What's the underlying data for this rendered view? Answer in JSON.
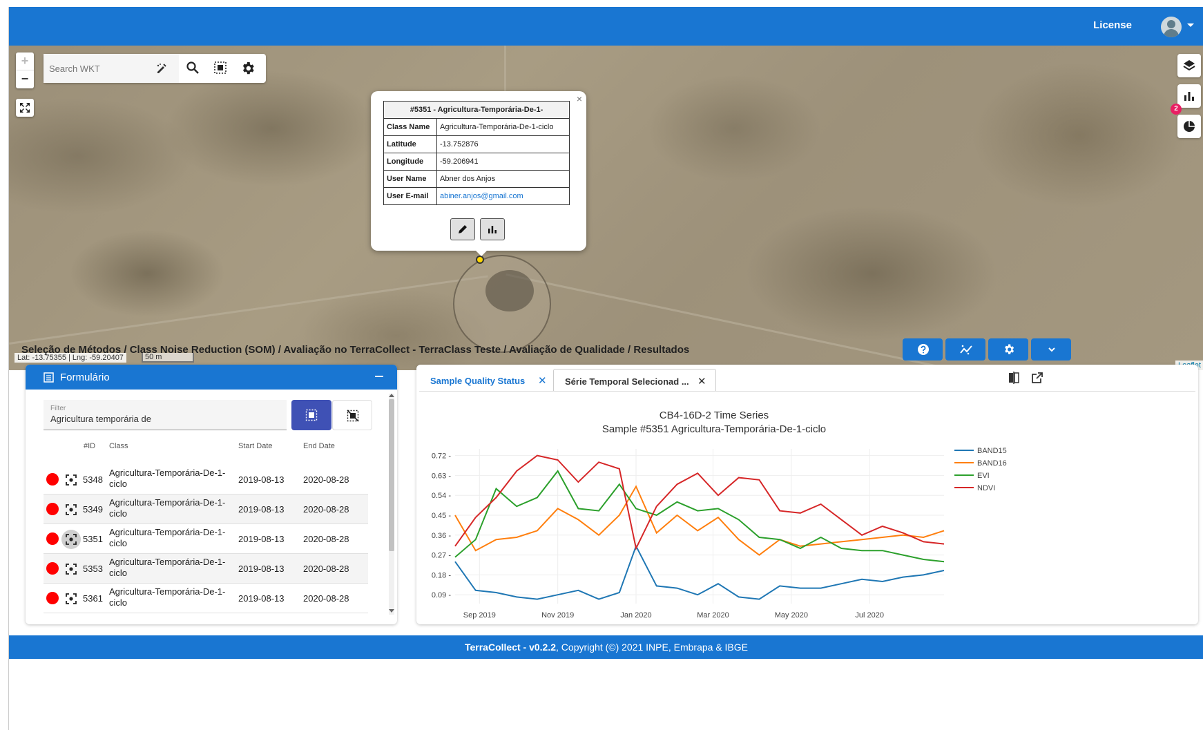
{
  "topbar": {
    "license": "License"
  },
  "map": {
    "search_placeholder": "Search WKT",
    "coords": "Lat: -13.75355 | Lng: -59.20407",
    "scale": "50 m",
    "attribution": "Leaflet",
    "badge_count": "2",
    "zoom_in": "+",
    "zoom_out": "−",
    "popup": {
      "title": "#5351 - Agricultura-Temporária-De-1-",
      "close": "×",
      "rows": [
        {
          "key": "Class Name",
          "value": "Agricultura-Temporária-De-1-ciclo"
        },
        {
          "key": "Latitude",
          "value": "-13.752876"
        },
        {
          "key": "Longitude",
          "value": "-59.206941"
        },
        {
          "key": "User Name",
          "value": "Abner dos Anjos"
        },
        {
          "key": "User E-mail",
          "value": "abiner.anjos@gmail.com"
        }
      ]
    }
  },
  "breadcrumb": "Seleção de Métodos / Class Noise Reduction (SOM) / Avaliação no TerraCollect - TerraClass Teste / Avaliação de Qualidade / Resultados",
  "form": {
    "title": "Formulário",
    "filter_label": "Filter",
    "filter_value": "Agricultura temporária de",
    "headers": {
      "id": "#ID",
      "class": "Class",
      "start": "Start Date",
      "end": "End Date"
    },
    "rows": [
      {
        "id": "5348",
        "class": "Agricultura-Temporária-De-1-ciclo",
        "start": "2019-08-13",
        "end": "2020-08-28"
      },
      {
        "id": "5349",
        "class": "Agricultura-Temporária-De-1-ciclo",
        "start": "2019-08-13",
        "end": "2020-08-28"
      },
      {
        "id": "5351",
        "class": "Agricultura-Temporária-De-1-ciclo",
        "start": "2019-08-13",
        "end": "2020-08-28"
      },
      {
        "id": "5353",
        "class": "Agricultura-Temporária-De-1-ciclo",
        "start": "2019-08-13",
        "end": "2020-08-28"
      },
      {
        "id": "5361",
        "class": "Agricultura-Temporária-De-1-ciclo",
        "start": "2019-08-13",
        "end": "2020-08-28"
      }
    ]
  },
  "tabs": [
    {
      "label": "Sample Quality Status",
      "close": "✕"
    },
    {
      "label": "Série Temporal Selecionad ...",
      "close": "✕"
    }
  ],
  "chart_data": {
    "type": "line",
    "title": "CB4-16D-2 Time Series",
    "subtitle": "Sample #5351 Agricultura-Temporária-De-1-ciclo",
    "xlabel": "",
    "ylabel": "",
    "x": [
      "2019-08-13",
      "2019-08-29",
      "2019-09-14",
      "2019-09-30",
      "2019-10-16",
      "2019-11-01",
      "2019-11-17",
      "2019-12-03",
      "2019-12-19",
      "2020-01-01",
      "2020-01-17",
      "2020-02-02",
      "2020-02-18",
      "2020-03-05",
      "2020-03-21",
      "2020-04-06",
      "2020-04-22",
      "2020-05-08",
      "2020-05-24",
      "2020-06-09",
      "2020-06-25",
      "2020-07-11",
      "2020-07-27",
      "2020-08-12",
      "2020-08-28"
    ],
    "series": [
      {
        "name": "BAND15",
        "color": "#1f77b4",
        "values": [
          0.24,
          0.11,
          0.1,
          0.08,
          0.07,
          0.09,
          0.11,
          0.07,
          0.1,
          0.31,
          0.13,
          0.12,
          0.09,
          0.14,
          0.08,
          0.07,
          0.13,
          0.12,
          0.12,
          0.14,
          0.16,
          0.15,
          0.17,
          0.18,
          0.2
        ]
      },
      {
        "name": "BAND16",
        "color": "#ff7f0e",
        "values": [
          0.45,
          0.29,
          0.34,
          0.35,
          0.38,
          0.48,
          0.43,
          0.36,
          0.45,
          0.58,
          0.37,
          0.45,
          0.38,
          0.44,
          0.34,
          0.27,
          0.34,
          0.31,
          0.32,
          0.33,
          0.34,
          0.35,
          0.36,
          0.35,
          0.38
        ]
      },
      {
        "name": "EVI",
        "color": "#2ca02c",
        "values": [
          0.26,
          0.34,
          0.57,
          0.49,
          0.53,
          0.65,
          0.48,
          0.47,
          0.59,
          0.48,
          0.45,
          0.51,
          0.47,
          0.48,
          0.43,
          0.35,
          0.34,
          0.3,
          0.35,
          0.3,
          0.29,
          0.29,
          0.27,
          0.25,
          0.24
        ]
      },
      {
        "name": "NDVI",
        "color": "#d62728",
        "values": [
          0.31,
          0.44,
          0.53,
          0.65,
          0.72,
          0.7,
          0.6,
          0.69,
          0.66,
          0.3,
          0.49,
          0.59,
          0.64,
          0.54,
          0.62,
          0.61,
          0.47,
          0.46,
          0.5,
          0.43,
          0.36,
          0.4,
          0.37,
          0.33,
          0.32
        ]
      }
    ],
    "yticks": [
      "0.72",
      "0.63",
      "0.54",
      "0.45",
      "0.36",
      "0.27",
      "0.18",
      "0.09"
    ],
    "xticks": [
      "Sep 2019",
      "Nov 2019",
      "Jan 2020",
      "Mar 2020",
      "May 2020",
      "Jul 2020"
    ],
    "ylim": [
      0.05,
      0.75
    ],
    "grid": true,
    "legend": "top-right"
  },
  "footer": {
    "brand": "TerraCollect - v0.2.2",
    "copyright": ", Copyright (©) 2021 INPE, Embrapa & IBGE"
  },
  "colors": {
    "primary": "#1976d2",
    "row_dot": "#ff0000",
    "marker": "#ffd600",
    "badge": "#e91e63"
  }
}
